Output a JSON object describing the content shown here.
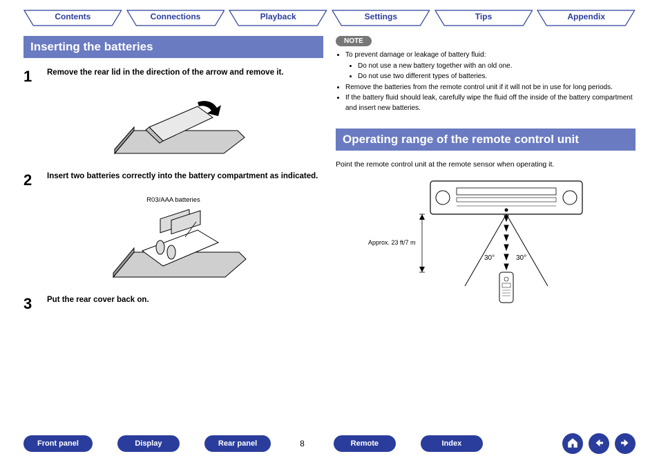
{
  "top_tabs": [
    "Contents",
    "Connections",
    "Playback",
    "Settings",
    "Tips",
    "Appendix"
  ],
  "left": {
    "heading": "Inserting the batteries",
    "steps": [
      {
        "n": "1",
        "text": "Remove the rear lid in the direction of the arrow and remove it."
      },
      {
        "n": "2",
        "text": "Insert two batteries correctly into the battery compartment as indicated."
      },
      {
        "n": "3",
        "text": "Put the rear cover back on."
      }
    ],
    "battery_label": "R03/AAA batteries"
  },
  "right": {
    "note_label": "NOTE",
    "notes": {
      "intro": "To prevent damage or leakage of battery fluid:",
      "sub": [
        "Do not use a new battery together with an old one.",
        "Do not use two different types of batteries."
      ],
      "rest": [
        "Remove the batteries from the remote control unit if it will not be in use for long periods.",
        "If the battery fluid should leak, carefully wipe the fluid off the inside of the battery compartment and insert new batteries."
      ]
    },
    "heading2": "Operating range of the remote control unit",
    "range_text": "Point the remote control unit at the remote sensor when operating it.",
    "diagram": {
      "distance": "Approx. 23 ft/7 m",
      "angle_left": "30°",
      "angle_right": "30°"
    }
  },
  "bottom": {
    "buttons_left": [
      "Front panel",
      "Display",
      "Rear panel"
    ],
    "page": "8",
    "buttons_right": [
      "Remote",
      "Index"
    ]
  }
}
